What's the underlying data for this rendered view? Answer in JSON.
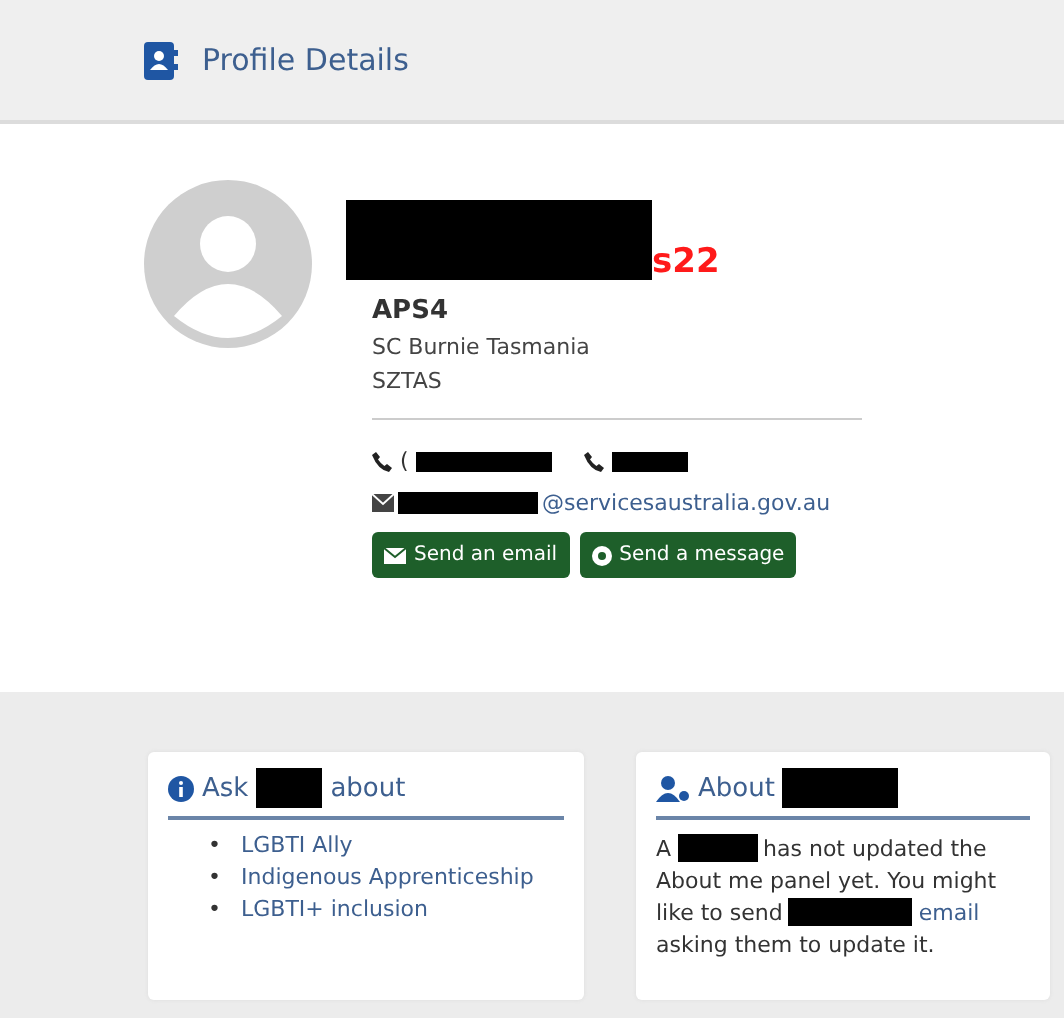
{
  "header": {
    "title": "Profile Details"
  },
  "profile": {
    "name_mark": "s22",
    "grade": "APS4",
    "location_lines": [
      "SC Burnie Tasmania",
      "SZTAS"
    ],
    "phone_prefix": "(",
    "email": {
      "domain": "@servicesaustralia.gov.au"
    },
    "buttons": [
      {
        "kind": "email",
        "label": "Send an email"
      },
      {
        "kind": "message",
        "label": "Send a message"
      }
    ]
  },
  "ask_card": {
    "title_before": "Ask",
    "title_after": "about",
    "items": [
      {
        "marker": "•",
        "text": "LGBTI Ally"
      },
      {
        "marker": "•",
        "text": "Indigenous Apprenticeship"
      },
      {
        "marker": "•",
        "text": "LGBTI+ inclusion"
      }
    ]
  },
  "about_card": {
    "title": "About",
    "lines": [
      [
        {
          "kind": "text",
          "text": "A"
        },
        {
          "kind": "redaction"
        },
        {
          "kind": "text",
          "text": "has not updated the"
        }
      ],
      [
        {
          "kind": "text",
          "text": "About me panel yet. You might"
        }
      ],
      [
        {
          "kind": "text",
          "text": "like to send"
        },
        {
          "kind": "redaction"
        },
        {
          "kind": "link",
          "text": "email"
        }
      ],
      [
        {
          "kind": "text",
          "text": "asking them to update it."
        }
      ]
    ]
  }
}
